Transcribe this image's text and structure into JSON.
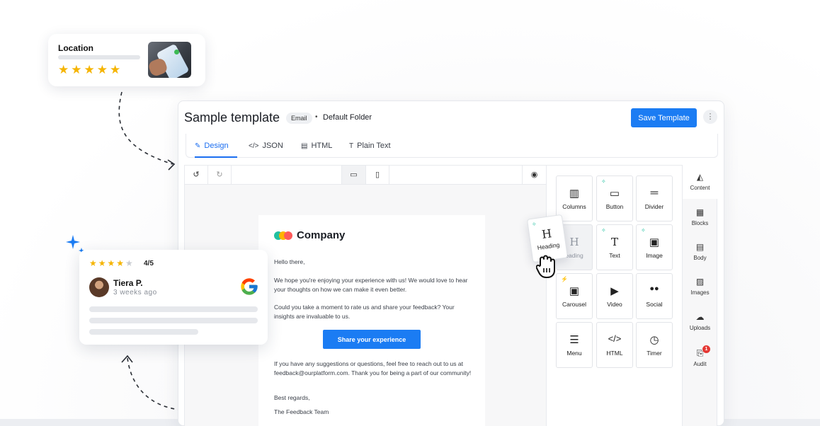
{
  "location_card": {
    "title": "Location",
    "stars": "★★★★★",
    "rating_filled": 5,
    "rating_max": 5,
    "photo_icon": "phone-map-photo"
  },
  "editor": {
    "title": "Sample template",
    "badge": "Email",
    "separator": "•",
    "folder": "Default Folder",
    "save_label": "Save Template",
    "more_label": "⋮",
    "tabs": [
      {
        "icon": "✎",
        "label": "Design",
        "active": true
      },
      {
        "icon": "</>",
        "label": "JSON"
      },
      {
        "icon": "▤",
        "label": "HTML"
      },
      {
        "icon": "T",
        "label": "Plain Text"
      }
    ],
    "toolbar": {
      "undo": "↺",
      "redo": "↻",
      "desktop": "▭",
      "mobile": "▯",
      "preview": "◉"
    }
  },
  "email": {
    "company": "Company",
    "greeting": "Hello there,",
    "p1": "We hope you're enjoying your experience with us! We would love to hear your thoughts on how we can make it even better.",
    "p2": "Could you take a moment to rate us and share your feedback? Your insights are invaluable to us.",
    "cta": "Share your experience",
    "p3": "If you have any suggestions or questions, feel free to reach out to us at feedback@ourplatform.com. Thank you for being a part of our community!",
    "closing": "Best regards,",
    "signature": "The Feedback Team"
  },
  "tools": [
    {
      "glyph": "▥",
      "label": "Columns"
    },
    {
      "glyph": "▭",
      "label": "Button",
      "spark": true
    },
    {
      "glyph": "═",
      "label": "Divider"
    },
    {
      "glyph": "H",
      "label": "Heading"
    },
    {
      "glyph": "T",
      "label": "Text",
      "spark": true
    },
    {
      "glyph": "▣",
      "label": "Image",
      "spark": true
    },
    {
      "glyph": "▣",
      "label": "Carousel",
      "bolt": true
    },
    {
      "glyph": "▶",
      "label": "Video"
    },
    {
      "glyph": "●●",
      "label": "Social"
    },
    {
      "glyph": "☰",
      "label": "Menu"
    },
    {
      "glyph": "</>",
      "label": "HTML"
    },
    {
      "glyph": "◷",
      "label": "Timer"
    }
  ],
  "dragging": {
    "glyph": "H",
    "label": "Heading",
    "ghost_label": "eading",
    "spark": "✧"
  },
  "side": [
    {
      "glyph": "◭",
      "label": "Content"
    },
    {
      "glyph": "▦",
      "label": "Blocks"
    },
    {
      "glyph": "▤",
      "label": "Body"
    },
    {
      "glyph": "▨",
      "label": "Images"
    },
    {
      "glyph": "☁",
      "label": "Uploads"
    },
    {
      "glyph": "⎘",
      "label": "Audit",
      "badge": "1"
    }
  ],
  "review": {
    "stars": "★★★★",
    "star_off": "★",
    "rating": 4,
    "rating_max": 5,
    "score": "4/5",
    "name": "Tiera P.",
    "when": "3 weeks ago"
  },
  "colors": {
    "accent": "#1b7cf3",
    "star": "#f5b400",
    "spark": "#21c0a0",
    "badge": "#e53935"
  }
}
